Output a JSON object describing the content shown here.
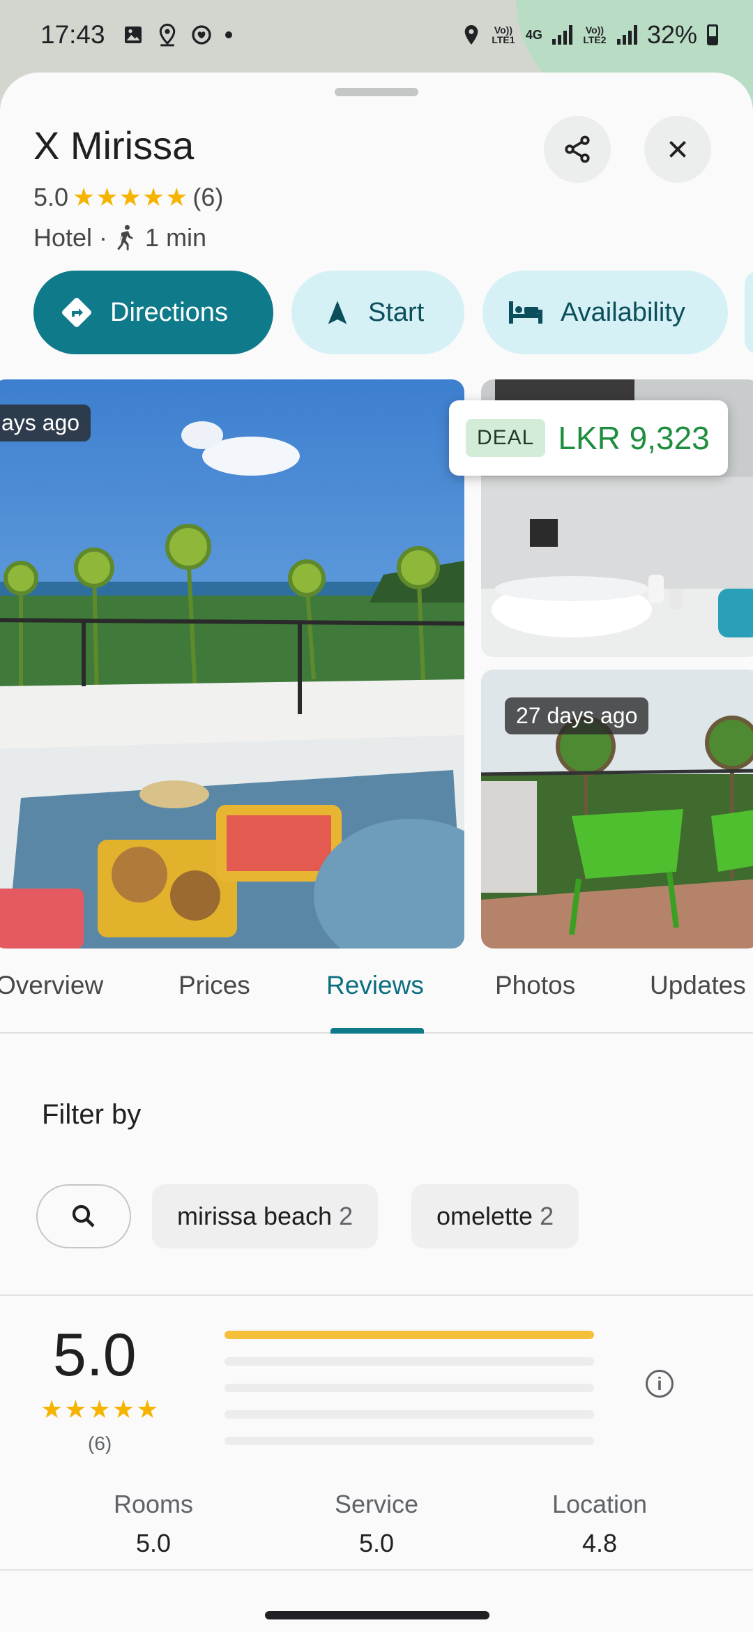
{
  "status_bar": {
    "time": "17:43",
    "sim1_label": "Vo)) LTE1",
    "network": "4G",
    "sim2_label": "Vo)) LTE2",
    "battery": "32%"
  },
  "place": {
    "name": "X Mirissa",
    "rating": "5.0",
    "rating_count": "(6)",
    "type": "Hotel",
    "walk_time": "1 min"
  },
  "actions": {
    "directions": "Directions",
    "start": "Start",
    "availability": "Availability"
  },
  "photos": {
    "main_tag": "ays ago",
    "deal_badge": "DEAL",
    "deal_price": "LKR 9,323",
    "second_tag": "27 days ago"
  },
  "tabs": [
    "Overview",
    "Prices",
    "Reviews",
    "Photos",
    "Updates"
  ],
  "active_tab": "Reviews",
  "filter": {
    "title": "Filter by",
    "chips": [
      {
        "label": "mirissa beach",
        "count": "2"
      },
      {
        "label": "omelette",
        "count": "2"
      }
    ]
  },
  "summary": {
    "score": "5.0",
    "stars": "★★★★★",
    "count": "(6)",
    "distribution": [
      1.0,
      0,
      0,
      0,
      0
    ],
    "categories": [
      {
        "name": "Rooms",
        "value": "5.0"
      },
      {
        "name": "Service",
        "value": "5.0"
      },
      {
        "name": "Location",
        "value": "4.8"
      }
    ]
  },
  "colors": {
    "accent": "#0e7a8a",
    "star": "#f4b400",
    "deal_price": "#1e8e3e"
  }
}
